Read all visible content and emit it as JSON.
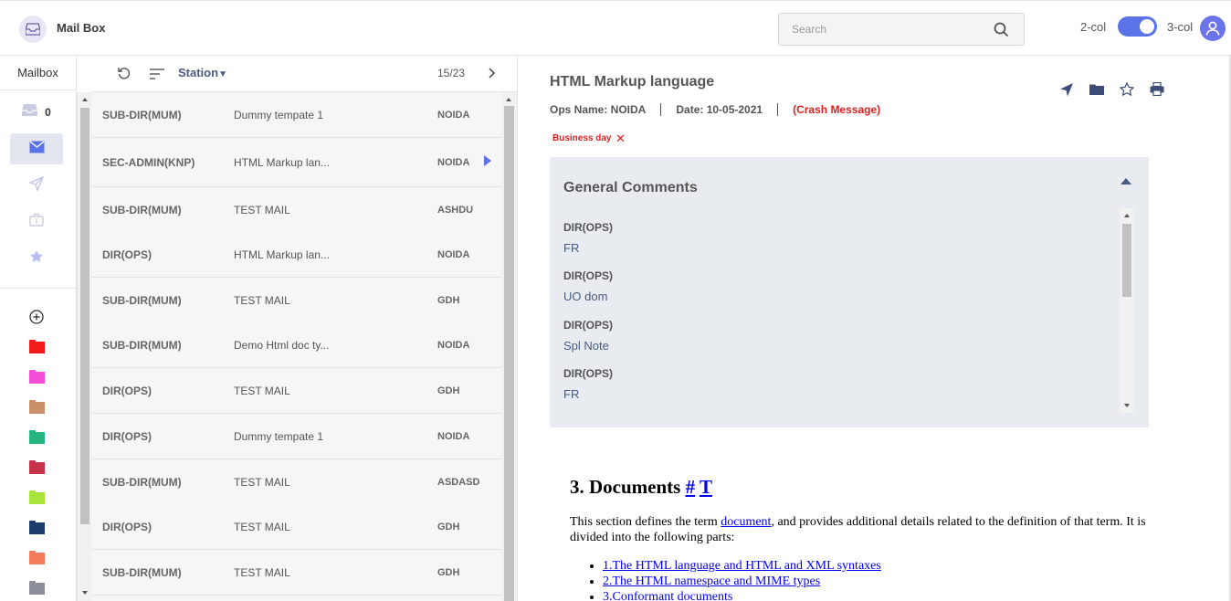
{
  "app": {
    "title": "Mail Box"
  },
  "search": {
    "placeholder": "Search",
    "value": ""
  },
  "view_toggle": {
    "left_label": "2-col",
    "right_label": "3-col",
    "selected": "3-col"
  },
  "nav": {
    "title": "Mailbox",
    "inbox_count": "0",
    "items": [
      "inbox-icon",
      "mail-icon",
      "send-icon",
      "briefcase-icon",
      "star-icon"
    ],
    "add_folder_icon": "plus-circle-icon",
    "folder_colors": [
      "#f21b1b",
      "#f44ed8",
      "#c98f68",
      "#27b57f",
      "#c7324b",
      "#a8e43a",
      "#1a3d6b",
      "#f47c5c",
      "#8c8f99"
    ]
  },
  "list": {
    "sort_label": "Station",
    "pager": "15/23",
    "rows": [
      {
        "sender": "SUB-DIR(MUM)",
        "subject": "Dummy tempate 1",
        "station": "NOIDA"
      },
      {
        "sender": "SEC-ADMIN(KNP)",
        "subject": "HTML Markup lan...",
        "station": "NOIDA"
      },
      {
        "sender": "SUB-DIR(MUM)",
        "subject": "TEST MAIL",
        "station": "ASHDU"
      },
      {
        "sender": "DIR(OPS)",
        "subject": "HTML Markup lan...",
        "station": "NOIDA"
      },
      {
        "sender": "SUB-DIR(MUM)",
        "subject": "TEST MAIL",
        "station": "GDH"
      },
      {
        "sender": "SUB-DIR(MUM)",
        "subject": "Demo Html doc ty...",
        "station": "NOIDA"
      },
      {
        "sender": "DIR(OPS)",
        "subject": "TEST MAIL",
        "station": "GDH"
      },
      {
        "sender": "DIR(OPS)",
        "subject": "Dummy tempate 1",
        "station": "NOIDA"
      },
      {
        "sender": "SUB-DIR(MUM)",
        "subject": "TEST MAIL",
        "station": "ASDASD"
      },
      {
        "sender": "DIR(OPS)",
        "subject": "TEST MAIL",
        "station": "GDH"
      },
      {
        "sender": "SUB-DIR(MUM)",
        "subject": "TEST MAIL",
        "station": "GDH"
      }
    ]
  },
  "message": {
    "title": "HTML Markup language",
    "ops_name": "Ops Name: NOIDA",
    "date": "Date: 10-05-2021",
    "crash": "(Crash Message)",
    "tag": "Business day",
    "comments_title": "General Comments",
    "comments": [
      {
        "author": "DIR(OPS)",
        "text": "FR"
      },
      {
        "author": "DIR(OPS)",
        "text": "UO dom"
      },
      {
        "author": "DIR(OPS)",
        "text": "Spl Note"
      },
      {
        "author": "DIR(OPS)",
        "text": "FR"
      }
    ],
    "doc": {
      "heading": "3. Documents",
      "heading_link1": "#",
      "heading_link2": "T",
      "para_before": "This section defines the term ",
      "para_link": "document",
      "para_after": ", and provides additional details related to the definition of that term. It is divided into the following parts:",
      "links": [
        "1.The HTML language and HTML and XML syntaxes",
        "2.The HTML namespace and MIME types",
        "3.Conformant documents"
      ]
    }
  }
}
